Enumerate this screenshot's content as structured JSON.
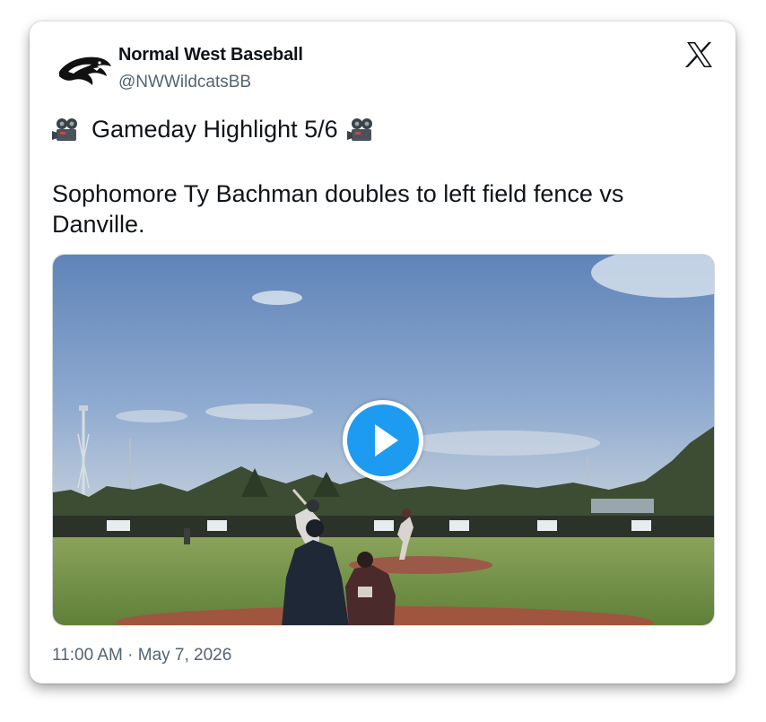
{
  "author": {
    "display_name": "Normal West Baseball",
    "handle": "@NWWildcatsBB",
    "avatar_icon": "wildcat-logo-icon"
  },
  "brand": {
    "logo_icon": "x-logo-icon"
  },
  "tweet": {
    "headline": "Gameday Highlight 5/6",
    "headline_icon": "movie-camera-icon",
    "body": "Sophomore Ty Bachman doubles to left field fence vs Danville.",
    "timestamp": "11:00 AM · May 7, 2026"
  },
  "media": {
    "type": "video",
    "play_icon": "play-icon"
  },
  "colors": {
    "text_primary": "#0f1419",
    "text_secondary": "#536471",
    "play_button": "#1d9bf0"
  }
}
